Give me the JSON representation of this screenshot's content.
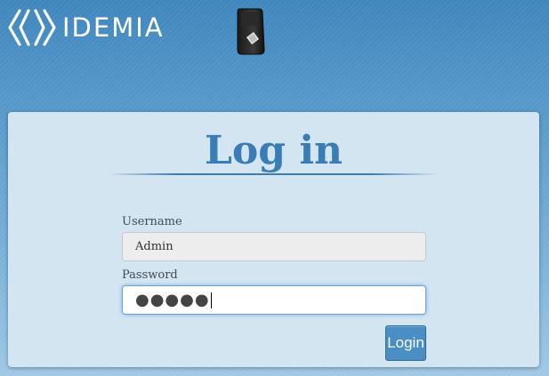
{
  "header": {
    "brand": "IDEMIA",
    "logo_icon": "idemia-brackets-logo",
    "device_icon": "fingerprint-terminal-icon"
  },
  "login": {
    "title": "Log in",
    "username_label": "Username",
    "username_value": "Admin",
    "password_label": "Password",
    "password_masked": "●●●●●",
    "submit_label": "Login"
  },
  "colors": {
    "accent": "#3a7db6",
    "panel": "#d4e5f2",
    "button": "#4a8fc4"
  }
}
